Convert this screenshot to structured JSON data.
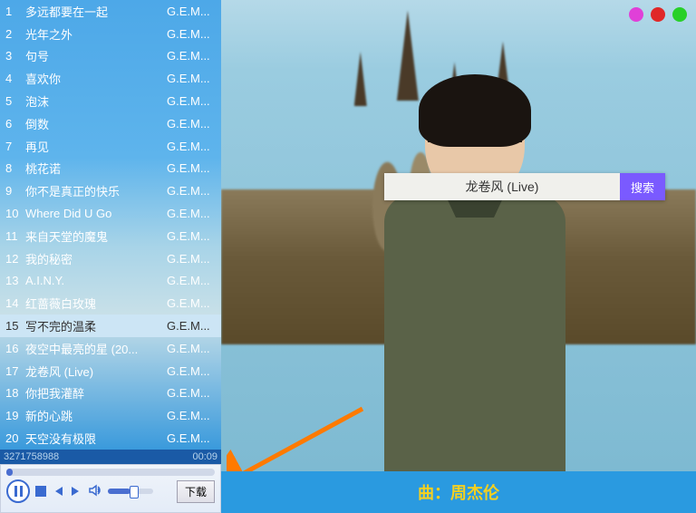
{
  "playlist": {
    "selected_index": 14,
    "items": [
      {
        "n": 1,
        "title": "多远都要在一起",
        "artist": "G.E.M..."
      },
      {
        "n": 2,
        "title": "光年之外",
        "artist": "G.E.M..."
      },
      {
        "n": 3,
        "title": "句号",
        "artist": "G.E.M..."
      },
      {
        "n": 4,
        "title": "喜欢你",
        "artist": "G.E.M..."
      },
      {
        "n": 5,
        "title": "泡沫",
        "artist": "G.E.M..."
      },
      {
        "n": 6,
        "title": "倒数",
        "artist": "G.E.M..."
      },
      {
        "n": 7,
        "title": "再见",
        "artist": "G.E.M..."
      },
      {
        "n": 8,
        "title": "桃花诺",
        "artist": "G.E.M..."
      },
      {
        "n": 9,
        "title": "你不是真正的快乐",
        "artist": "G.E.M..."
      },
      {
        "n": 10,
        "title": "Where Did U Go",
        "artist": "G.E.M..."
      },
      {
        "n": 11,
        "title": "来自天堂的魔鬼",
        "artist": "G.E.M..."
      },
      {
        "n": 12,
        "title": "我的秘密",
        "artist": "G.E.M..."
      },
      {
        "n": 13,
        "title": "A.I.N.Y.",
        "artist": "G.E.M..."
      },
      {
        "n": 14,
        "title": "红蔷薇白玫瑰",
        "artist": "G.E.M..."
      },
      {
        "n": 15,
        "title": "写不完的温柔",
        "artist": "G.E.M..."
      },
      {
        "n": 16,
        "title": "夜空中最亮的星 (20...",
        "artist": "G.E.M..."
      },
      {
        "n": 17,
        "title": "龙卷风 (Live)",
        "artist": "G.E.M..."
      },
      {
        "n": 18,
        "title": "你把我灌醉",
        "artist": "G.E.M..."
      },
      {
        "n": 19,
        "title": "新的心跳",
        "artist": "G.E.M..."
      },
      {
        "n": 20,
        "title": "天空没有极限",
        "artist": "G.E.M..."
      }
    ]
  },
  "status": {
    "left": "3271758988",
    "right": "00:09"
  },
  "player": {
    "download_label": "下载"
  },
  "search": {
    "value": "龙卷风 (Live)",
    "button_label": "搜索"
  },
  "traffic_colors": {
    "a": "#e040d8",
    "b": "#e02828",
    "c": "#28d028"
  },
  "now_playing_label": "曲：周杰伦"
}
